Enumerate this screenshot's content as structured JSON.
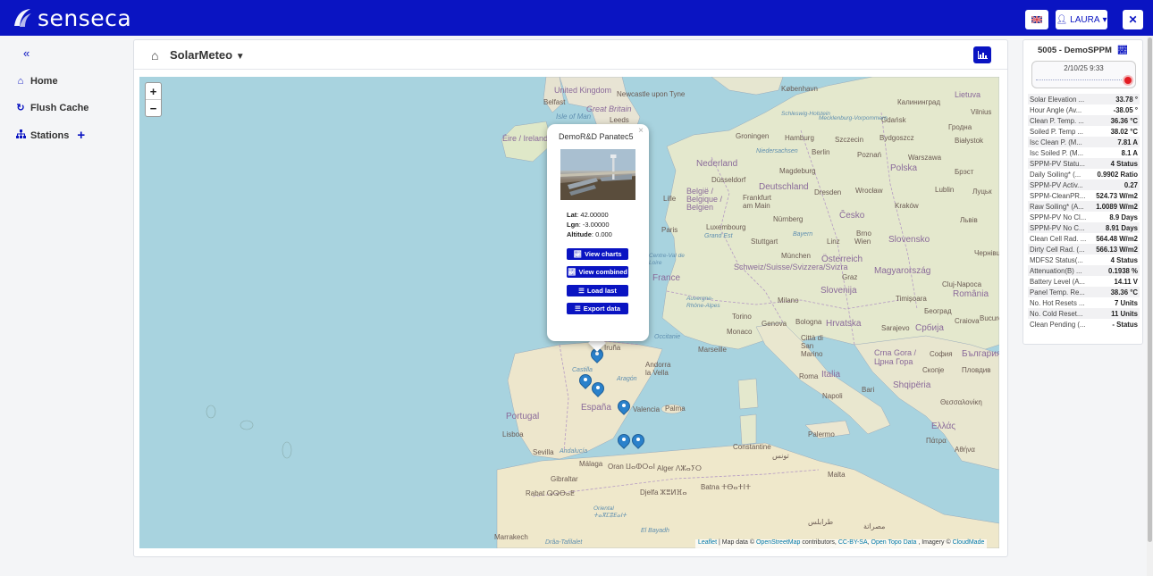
{
  "app": {
    "logo_text": "senseca"
  },
  "topbar": {
    "user_label": "LAURA",
    "flag": "UK flag",
    "close_icon": "✕"
  },
  "sidebar": {
    "collapse_label": "«",
    "items": [
      {
        "label": "Home",
        "icon": "home-icon"
      },
      {
        "label": "Flush Cache",
        "icon": "refresh-icon"
      },
      {
        "label": "Stations",
        "icon": "sitemap-icon",
        "add": "+"
      }
    ]
  },
  "panel": {
    "title": "SolarMeteo"
  },
  "map": {
    "zoom_in": "+",
    "zoom_out": "−",
    "labels": {
      "united_kingdom": "United Kingdom",
      "belfast": "Belfast",
      "newcastle": "Newcastle upon Tyne",
      "great_britain": "Great Britain",
      "isle_of_man": "Isle of Man",
      "leeds": "Leeds",
      "eire": "Éire / Ireland",
      "kobenhavn": "København",
      "lietuva": "Lietuva",
      "kaliningrad": "Калининград",
      "vilnius": "Vilnius",
      "gdansk": "Gdańsk",
      "grodno": "Гродна",
      "groningen": "Groningen",
      "hamburg": "Hamburg",
      "schleswig": "Schleswig-Holstein",
      "mecklenburg": "Mecklenburg-Vorpommern",
      "szczecin": "Szczecin",
      "bydgoszcz": "Bydgoszcz",
      "bialystok": "Białystok",
      "nederland": "Nederland",
      "niedersachsen": "Niedersachsen",
      "berlin": "Berlin",
      "poznan": "Poznań",
      "warszawa": "Warszawa",
      "magdeburg": "Magdeburg",
      "polska": "Polska",
      "brest": "Брэст",
      "dusseldorf": "Düsseldorf",
      "deutschland": "Deutschland",
      "dresden": "Dresden",
      "wroclaw": "Wrocław",
      "lublin": "Lublin",
      "lutsk": "Луцьк",
      "belgie": "België / Belgique / Belgien",
      "lille": "Lille",
      "frankfurt": "Frankfurt am Main",
      "krakow": "Kraków",
      "lviv": "Львів",
      "cesko": "Česko",
      "nurnberg": "Nürnberg",
      "luxembourg": "Luxembourg",
      "grand_est": "Grand Est",
      "paris": "Paris",
      "stuttgart": "Stuttgart",
      "bayern": "Bayern",
      "linz": "Linz",
      "brno": "Brno",
      "wien": "Wien",
      "slovensko": "Slovensko",
      "chernivtsi": "Чернівці",
      "munchen": "München",
      "osterreich": "Österreich",
      "centre_val": "Centre-Val de Loire",
      "france": "France",
      "schweiz": "Schweiz/Suisse/Svizzera/Svizra",
      "graz": "Graz",
      "magyarorszag": "Magyarország",
      "cluj": "Cluj-Napoca",
      "romania": "România",
      "slovenija": "Slovenija",
      "auvergne": "Auvergne-Rhône-Alpes",
      "milano": "Milano",
      "timisoara": "Timișoara",
      "beograd": "Београд",
      "torino": "Torino",
      "genova": "Genova",
      "bologna": "Bologna",
      "hrvatska": "Hrvatska",
      "sarajevo": "Sarajevo",
      "srbija": "Србија",
      "craiova": "Craiova",
      "bucuresti": "Bucure",
      "monaco": "Monaco",
      "citta_san_marino": "Città di San Marino",
      "occitanie": "Occitanie",
      "marseille": "Marseille",
      "crna_gora": "Crna Gora / Црна Гора",
      "sofia": "София",
      "bulgaria": "България",
      "iruna": "Iruña",
      "andorra": "Andorra la Vella",
      "roma": "Roma",
      "italia": "Italia",
      "skopje": "Скопје",
      "plovdiv": "Пловдив",
      "aragon": "Aragón",
      "castilla": "Castilla",
      "shqiperia": "Shqipëria",
      "napoli": "Napoli",
      "bari": "Bari",
      "thessaloniki": "Θεσσαλονίκη",
      "espana": "España",
      "portugal": "Portugal",
      "lisboa": "Lisboa",
      "valencia": "Valencia",
      "palma": "Palma",
      "ellas": "Ελλάς",
      "patra": "Πάτρα",
      "athina": "Αθήνα",
      "palermo": "Palermo",
      "sevilla": "Sevilla",
      "andalucia": "Andalucía",
      "constantine": "Constantine",
      "tunis": "تونس",
      "malaga": "Málaga",
      "oran": "Oran ⵡⴰⵀⵔⴰⵏ",
      "alger": "Alger ⴷⵣⴰⵢⵔ",
      "malta": "Malta",
      "gibraltar": "Gibraltar",
      "rabat": "Rabat ⵕⵕⴱⴰⵟ",
      "batna": "Batna ⵜⴱⴰⵜⵏⵜ",
      "djelfa": "Djelfa ⵣⴻⵍⴼⴰ",
      "oriental": "Oriental ⵜⴰⴳⵎⵓⴹⴰⵏⵜ",
      "el_bayadh": "El Bayadh",
      "tarabulus": "طرابلس",
      "misrata": "مصراتة",
      "marrakech": "Marrakech",
      "draa": "Drâa-Tafilalet"
    },
    "attribution": {
      "leaflet": "Leaflet",
      "prefix": " | Map data © ",
      "osm": "OpenStreetMap",
      "middle": " contributors, ",
      "cc": "CC-BY-SA",
      "sep": ", ",
      "otd": "Open Topo Data",
      "imagery": " , Imagery © ",
      "cloudmade": "CloudMade"
    }
  },
  "popup": {
    "title": "DemoR&D Panatec5",
    "close": "×",
    "lat_label": "Lat",
    "lat_value": ": 42.00000",
    "lgn_label": "Lgn",
    "lgn_value": ": -3.00000",
    "alt_label": "Altitude",
    "alt_value": ": 0.000",
    "buttons": [
      "View charts",
      "View combined",
      "Load last",
      "Export data"
    ]
  },
  "station": {
    "title": "5005 - DemoSPPM",
    "date": "2/10/25 9:33",
    "rows": [
      {
        "label": "Solar Elevation ...",
        "value": "33.78 °"
      },
      {
        "label": "Hour Angle (Av...",
        "value": "-38.05 °"
      },
      {
        "label": "Clean P. Temp. ...",
        "value": "36.36 °C"
      },
      {
        "label": "Soiled P. Temp ...",
        "value": "38.02 °C"
      },
      {
        "label": "Isc Clean P. (M...",
        "value": "7.81 A"
      },
      {
        "label": "Isc Soiled P. (M...",
        "value": "8.1 A"
      },
      {
        "label": "SPPM-PV Statu...",
        "value": "4 Status"
      },
      {
        "label": "Daily Soiling* (...",
        "value": "0.9902 Ratio"
      },
      {
        "label": "SPPM-PV Activ...",
        "value": "0.27"
      },
      {
        "label": "SPPM-CleanPR...",
        "value": "524.73 W/m2"
      },
      {
        "label": "Raw Soiling* (A...",
        "value": "1.0089 W/m2"
      },
      {
        "label": "SPPM-PV No Cl...",
        "value": "8.9 Days"
      },
      {
        "label": "SPPM-PV No C...",
        "value": "8.91 Days"
      },
      {
        "label": "Clean Cell Rad. ...",
        "value": "564.48 W/m2"
      },
      {
        "label": "Dirty Cell Rad. (...",
        "value": "566.13 W/m2"
      },
      {
        "label": "MDFS2 Status(...",
        "value": "4 Status"
      },
      {
        "label": "Attenuation(B) ...",
        "value": "0.1938 %"
      },
      {
        "label": "Battery Level (A...",
        "value": "14.11 V"
      },
      {
        "label": "Panel Temp. Re...",
        "value": "38.36 °C"
      },
      {
        "label": "No. Hot Resets ...",
        "value": "7 Units"
      },
      {
        "label": "No. Cold Reset...",
        "value": "11 Units"
      },
      {
        "label": "Clean Pending (...",
        "value": "- Status"
      }
    ]
  }
}
